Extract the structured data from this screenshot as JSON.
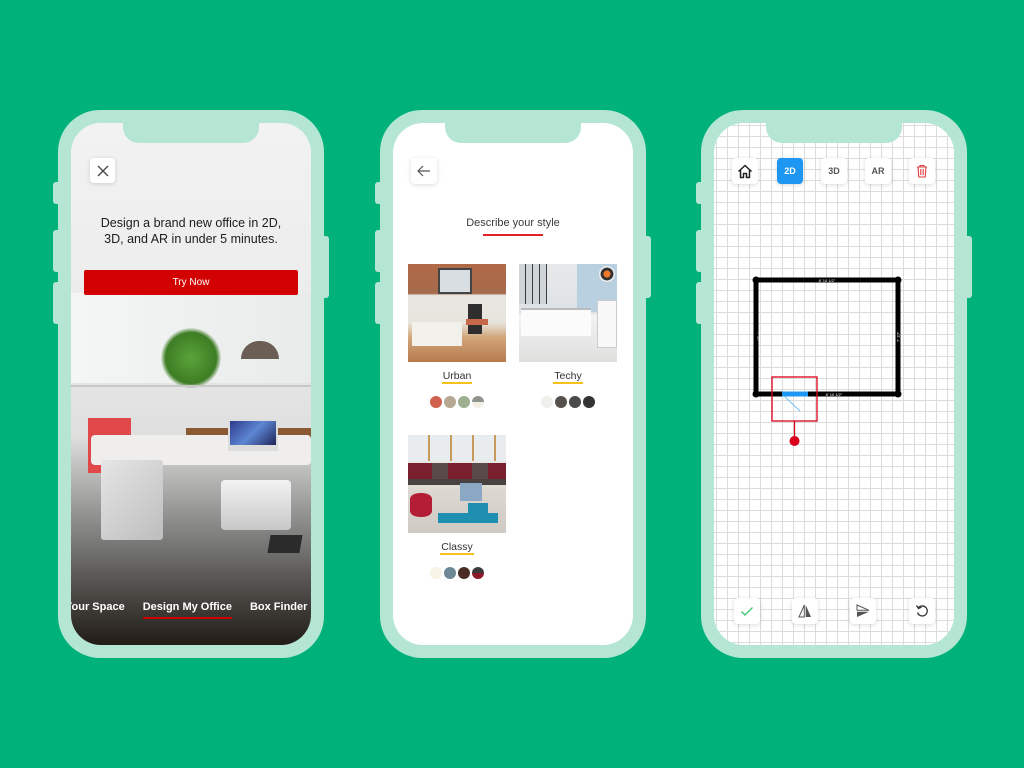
{
  "background_color": "#00b27a",
  "screens": {
    "intro": {
      "close_icon": "close-icon",
      "headline": "Design a brand new office in 2D, 3D, and AR in under 5 minutes.",
      "cta_label": "Try Now",
      "cta_color": "#d20000",
      "tabs": [
        {
          "label": "Your Space",
          "active": false
        },
        {
          "label": "Design My Office",
          "active": true
        },
        {
          "label": "Box Finder",
          "active": false
        }
      ]
    },
    "style": {
      "back_icon": "arrow-left-icon",
      "title": "Describe your style",
      "styles": [
        {
          "label": "Urban",
          "swatches": [
            "#d2604f",
            "#b5a791",
            "#9daf8f",
            "split:#8f948c/#f4efe3"
          ]
        },
        {
          "label": "Techy",
          "swatches": [
            "#efefeb",
            "#56514c",
            "#4a4a4a",
            "#333333"
          ]
        },
        {
          "label": "Classy",
          "swatches": [
            "#f7f3e6",
            "#6e8796",
            "#4b2b26",
            "split:#3b3b3b/#8a1a28"
          ]
        }
      ]
    },
    "planner": {
      "top_toolbar": [
        {
          "id": "home",
          "icon": "home-icon",
          "label": ""
        },
        {
          "id": "2d",
          "label": "2D",
          "active": true
        },
        {
          "id": "3d",
          "label": "3D",
          "active": false
        },
        {
          "id": "ar",
          "label": "AR",
          "active": false
        },
        {
          "id": "delete",
          "icon": "trash-icon",
          "label": ""
        }
      ],
      "dimensions": {
        "top": "8' 10 1/2\"",
        "bottom": "8' 10 1/2\"",
        "left": "7' 10\"",
        "right": "7' 10\""
      },
      "accent_color": "#1e97f3",
      "selection_color": "#d9001b",
      "bottom_toolbar": [
        {
          "id": "confirm",
          "icon": "check-icon"
        },
        {
          "id": "flip-horizontal",
          "icon": "flip-horizontal-icon"
        },
        {
          "id": "flip-vertical",
          "icon": "flip-vertical-icon"
        },
        {
          "id": "undo",
          "icon": "undo-icon"
        }
      ]
    }
  }
}
